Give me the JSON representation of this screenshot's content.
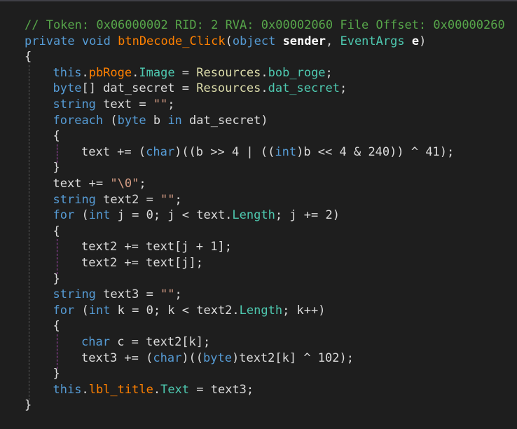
{
  "code": {
    "lines": [
      {
        "indent": 0,
        "tokens": [
          {
            "t": "comment",
            "v": "// Token: 0x06000002 RID: 2 RVA: 0x00002060 File Offset: 0x00000260"
          }
        ]
      },
      {
        "indent": 0,
        "tokens": [
          {
            "t": "keyword",
            "v": "private"
          },
          {
            "t": "plain",
            "v": " "
          },
          {
            "t": "keyword",
            "v": "void"
          },
          {
            "t": "plain",
            "v": " "
          },
          {
            "t": "method",
            "v": "btnDecode_Click"
          },
          {
            "t": "plain",
            "v": "("
          },
          {
            "t": "keyword",
            "v": "object"
          },
          {
            "t": "plain",
            "v": " "
          },
          {
            "t": "param",
            "v": "sender"
          },
          {
            "t": "plain",
            "v": ", "
          },
          {
            "t": "type",
            "v": "EventArgs"
          },
          {
            "t": "plain",
            "v": " "
          },
          {
            "t": "param",
            "v": "e"
          },
          {
            "t": "plain",
            "v": ")"
          }
        ]
      },
      {
        "indent": 0,
        "tokens": [
          {
            "t": "plain",
            "v": "{"
          }
        ]
      },
      {
        "indent": 1,
        "tokens": [
          {
            "t": "keyword",
            "v": "this"
          },
          {
            "t": "plain",
            "v": "."
          },
          {
            "t": "member2",
            "v": "pbRoge"
          },
          {
            "t": "plain",
            "v": "."
          },
          {
            "t": "prop",
            "v": "Image"
          },
          {
            "t": "plain",
            "v": " = "
          },
          {
            "t": "cls",
            "v": "Resources"
          },
          {
            "t": "plain",
            "v": "."
          },
          {
            "t": "prop",
            "v": "bob_roge"
          },
          {
            "t": "plain",
            "v": ";"
          }
        ]
      },
      {
        "indent": 1,
        "tokens": [
          {
            "t": "keyword",
            "v": "byte"
          },
          {
            "t": "plain",
            "v": "[] dat_secret = "
          },
          {
            "t": "cls",
            "v": "Resources"
          },
          {
            "t": "plain",
            "v": "."
          },
          {
            "t": "prop",
            "v": "dat_secret"
          },
          {
            "t": "plain",
            "v": ";"
          }
        ]
      },
      {
        "indent": 1,
        "tokens": [
          {
            "t": "keyword",
            "v": "string"
          },
          {
            "t": "plain",
            "v": " text = "
          },
          {
            "t": "string",
            "v": "\"\""
          },
          {
            "t": "plain",
            "v": ";"
          }
        ]
      },
      {
        "indent": 1,
        "tokens": [
          {
            "t": "keyword",
            "v": "foreach"
          },
          {
            "t": "plain",
            "v": " ("
          },
          {
            "t": "keyword",
            "v": "byte"
          },
          {
            "t": "plain",
            "v": " b "
          },
          {
            "t": "keyword",
            "v": "in"
          },
          {
            "t": "plain",
            "v": " dat_secret)"
          }
        ]
      },
      {
        "indent": 1,
        "tokens": [
          {
            "t": "plain",
            "v": "{"
          }
        ]
      },
      {
        "indent": 2,
        "tokens": [
          {
            "t": "plain",
            "v": "text += ("
          },
          {
            "t": "keyword",
            "v": "char"
          },
          {
            "t": "plain",
            "v": ")((b >> 4 | (("
          },
          {
            "t": "keyword",
            "v": "int"
          },
          {
            "t": "plain",
            "v": ")b << 4 & 240)) ^ 41);"
          }
        ]
      },
      {
        "indent": 1,
        "tokens": [
          {
            "t": "plain",
            "v": "}"
          }
        ]
      },
      {
        "indent": 1,
        "tokens": [
          {
            "t": "plain",
            "v": "text += "
          },
          {
            "t": "string",
            "v": "\"\\0\""
          },
          {
            "t": "plain",
            "v": ";"
          }
        ]
      },
      {
        "indent": 1,
        "tokens": [
          {
            "t": "keyword",
            "v": "string"
          },
          {
            "t": "plain",
            "v": " text2 = "
          },
          {
            "t": "string",
            "v": "\"\""
          },
          {
            "t": "plain",
            "v": ";"
          }
        ]
      },
      {
        "indent": 1,
        "tokens": [
          {
            "t": "keyword",
            "v": "for"
          },
          {
            "t": "plain",
            "v": " ("
          },
          {
            "t": "keyword",
            "v": "int"
          },
          {
            "t": "plain",
            "v": " j = 0; j < text."
          },
          {
            "t": "prop",
            "v": "Length"
          },
          {
            "t": "plain",
            "v": "; j += 2)"
          }
        ]
      },
      {
        "indent": 1,
        "tokens": [
          {
            "t": "plain",
            "v": "{"
          }
        ]
      },
      {
        "indent": 2,
        "tokens": [
          {
            "t": "plain",
            "v": "text2 += text[j + 1];"
          }
        ]
      },
      {
        "indent": 2,
        "tokens": [
          {
            "t": "plain",
            "v": "text2 += text[j];"
          }
        ]
      },
      {
        "indent": 1,
        "tokens": [
          {
            "t": "plain",
            "v": "}"
          }
        ]
      },
      {
        "indent": 1,
        "tokens": [
          {
            "t": "keyword",
            "v": "string"
          },
          {
            "t": "plain",
            "v": " text3 = "
          },
          {
            "t": "string",
            "v": "\"\""
          },
          {
            "t": "plain",
            "v": ";"
          }
        ]
      },
      {
        "indent": 1,
        "tokens": [
          {
            "t": "keyword",
            "v": "for"
          },
          {
            "t": "plain",
            "v": " ("
          },
          {
            "t": "keyword",
            "v": "int"
          },
          {
            "t": "plain",
            "v": " k = 0; k < text2."
          },
          {
            "t": "prop",
            "v": "Length"
          },
          {
            "t": "plain",
            "v": "; k++)"
          }
        ]
      },
      {
        "indent": 1,
        "tokens": [
          {
            "t": "plain",
            "v": "{"
          }
        ]
      },
      {
        "indent": 2,
        "tokens": [
          {
            "t": "keyword",
            "v": "char"
          },
          {
            "t": "plain",
            "v": " c = text2[k];"
          }
        ]
      },
      {
        "indent": 2,
        "tokens": [
          {
            "t": "plain",
            "v": "text3 += ("
          },
          {
            "t": "keyword",
            "v": "char"
          },
          {
            "t": "plain",
            "v": ")(("
          },
          {
            "t": "keyword",
            "v": "byte"
          },
          {
            "t": "plain",
            "v": ")text2[k] ^ 102);"
          }
        ]
      },
      {
        "indent": 1,
        "tokens": [
          {
            "t": "plain",
            "v": "}"
          }
        ]
      },
      {
        "indent": 1,
        "tokens": [
          {
            "t": "keyword",
            "v": "this"
          },
          {
            "t": "plain",
            "v": "."
          },
          {
            "t": "member2",
            "v": "lbl_title"
          },
          {
            "t": "plain",
            "v": "."
          },
          {
            "t": "prop",
            "v": "Text"
          },
          {
            "t": "plain",
            "v": " = text3;"
          }
        ]
      },
      {
        "indent": 0,
        "tokens": [
          {
            "t": "plain",
            "v": "}"
          }
        ]
      }
    ]
  },
  "colors": {
    "background": "#1e1e1e",
    "comment": "#57a64a",
    "keyword": "#569cd6",
    "method": "#ff8000",
    "type": "#4ec9b0",
    "string": "#d69d85",
    "plain": "#dcdcdc"
  }
}
